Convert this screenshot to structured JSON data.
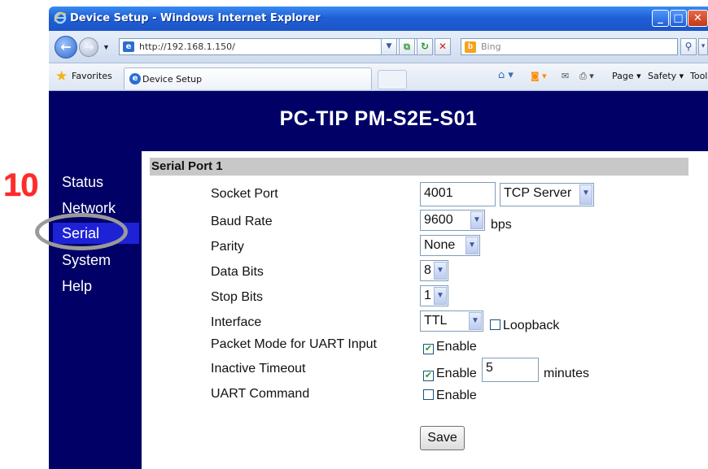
{
  "browser": {
    "window_title": "Device Setup - Windows Internet Explorer",
    "address": "http://192.168.1.150/",
    "search_placeholder": "Bing",
    "favorites_label": "Favorites",
    "tab_title": "Device Setup",
    "commands": {
      "page": "Page ▾",
      "safety": "Safety ▾",
      "tools": "Tools ▾"
    },
    "chrome_color": "#1f5fd6"
  },
  "page": {
    "title": "PC-TIP PM-S2E-S01",
    "background": "#000066",
    "sidebar": {
      "items": [
        {
          "label": "Status"
        },
        {
          "label": "Network"
        },
        {
          "label": "Serial",
          "active": true
        },
        {
          "label": "System"
        },
        {
          "label": "Help"
        }
      ]
    },
    "section_title": "Serial Port 1",
    "form": {
      "socket_port": {
        "label": "Socket Port",
        "value": "4001",
        "mode": "TCP Server"
      },
      "baud_rate": {
        "label": "Baud Rate",
        "value": "9600",
        "unit": "bps"
      },
      "parity": {
        "label": "Parity",
        "value": "None"
      },
      "data_bits": {
        "label": "Data Bits",
        "value": "8"
      },
      "stop_bits": {
        "label": "Stop Bits",
        "value": "1"
      },
      "interface": {
        "label": "Interface",
        "value": "TTL",
        "loopback_label": "Loopback",
        "loopback_checked": false
      },
      "packet_mode": {
        "label": "Packet Mode for UART Input",
        "enable_label": "Enable",
        "checked": true
      },
      "inactive_timeout": {
        "label": "Inactive Timeout",
        "enable_label": "Enable",
        "checked": true,
        "value": "5",
        "unit": "minutes"
      },
      "uart_command": {
        "label": "UART Command",
        "enable_label": "Enable",
        "checked": false
      }
    },
    "save_label": "Save"
  },
  "annotation": {
    "step_number": "10",
    "highlight_color": "#e82020"
  }
}
